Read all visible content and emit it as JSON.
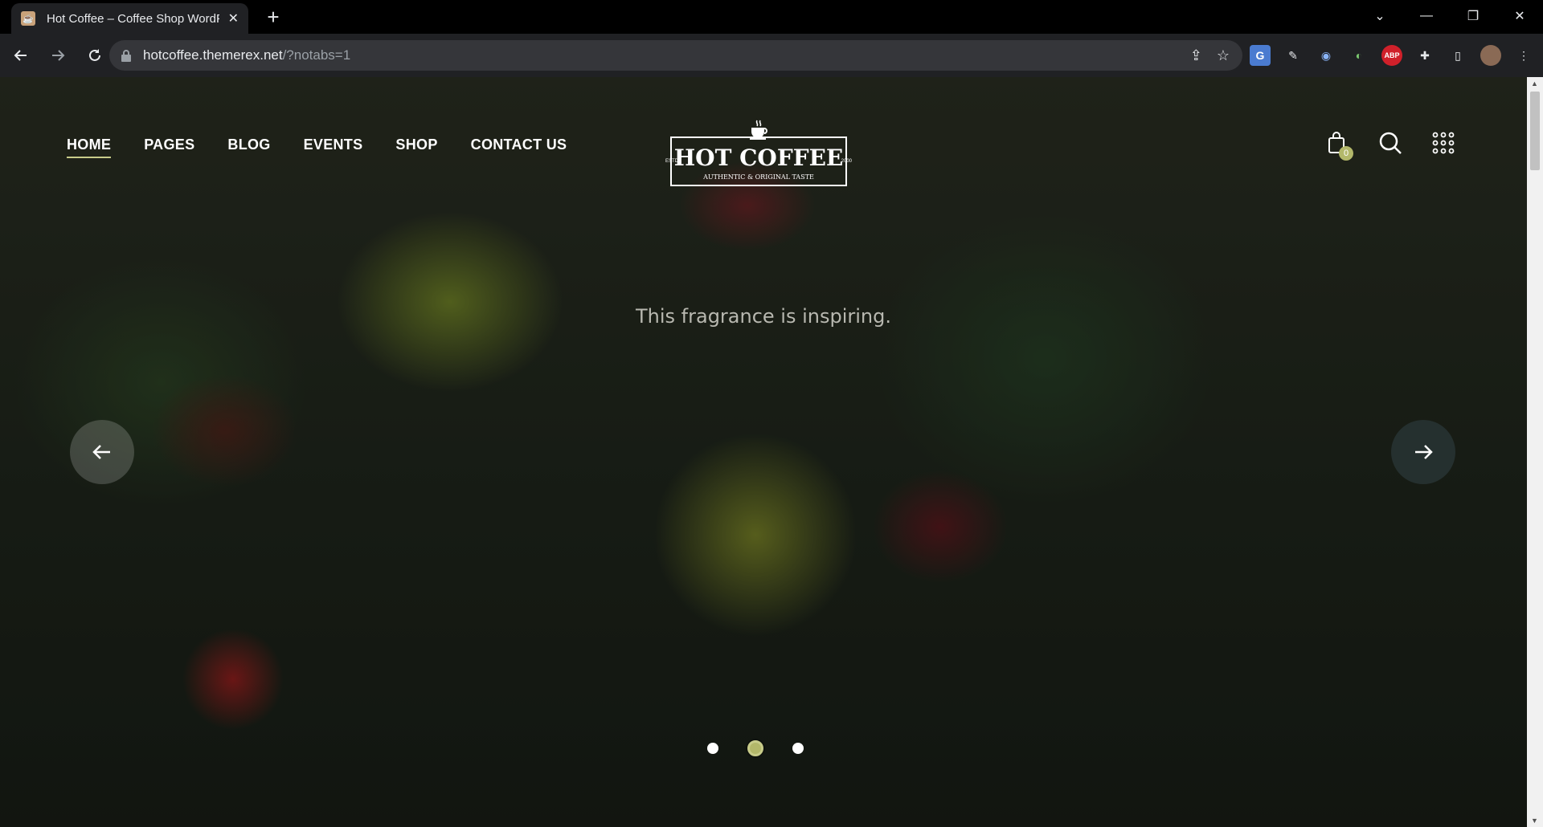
{
  "browser": {
    "tab_title": "Hot Coffee – Coffee Shop WordPress Theme",
    "new_tab_label": "+",
    "url_host": "hotcoffee.themerex.net",
    "url_path": "/?notabs=1",
    "extensions": [
      "translate-icon",
      "eyedropper-icon",
      "shield-extension-icon",
      "color-extension-icon",
      "adblock-icon",
      "puzzle-icon",
      "sidepanel-icon",
      "profile-avatar"
    ]
  },
  "header": {
    "nav": [
      {
        "label": "HOME",
        "active": true
      },
      {
        "label": "PAGES",
        "active": false
      },
      {
        "label": "BLOG",
        "active": false
      },
      {
        "label": "EVENTS",
        "active": false
      },
      {
        "label": "SHOP",
        "active": false
      },
      {
        "label": "CONTACT US",
        "active": false
      }
    ],
    "logo": {
      "name": "HOT COFFEE",
      "tagline": "AUTHENTIC & ORIGINAL TASTE",
      "estd": "ESTD",
      "year": "2000"
    },
    "cart_count": "0"
  },
  "slider": {
    "caption": "This fragrance is inspiring.",
    "slide_count": 3,
    "active_slide": 2
  },
  "colors": {
    "accent": "#b3b86a",
    "chrome_bg": "#202124",
    "omnibox_bg": "#35363a"
  }
}
